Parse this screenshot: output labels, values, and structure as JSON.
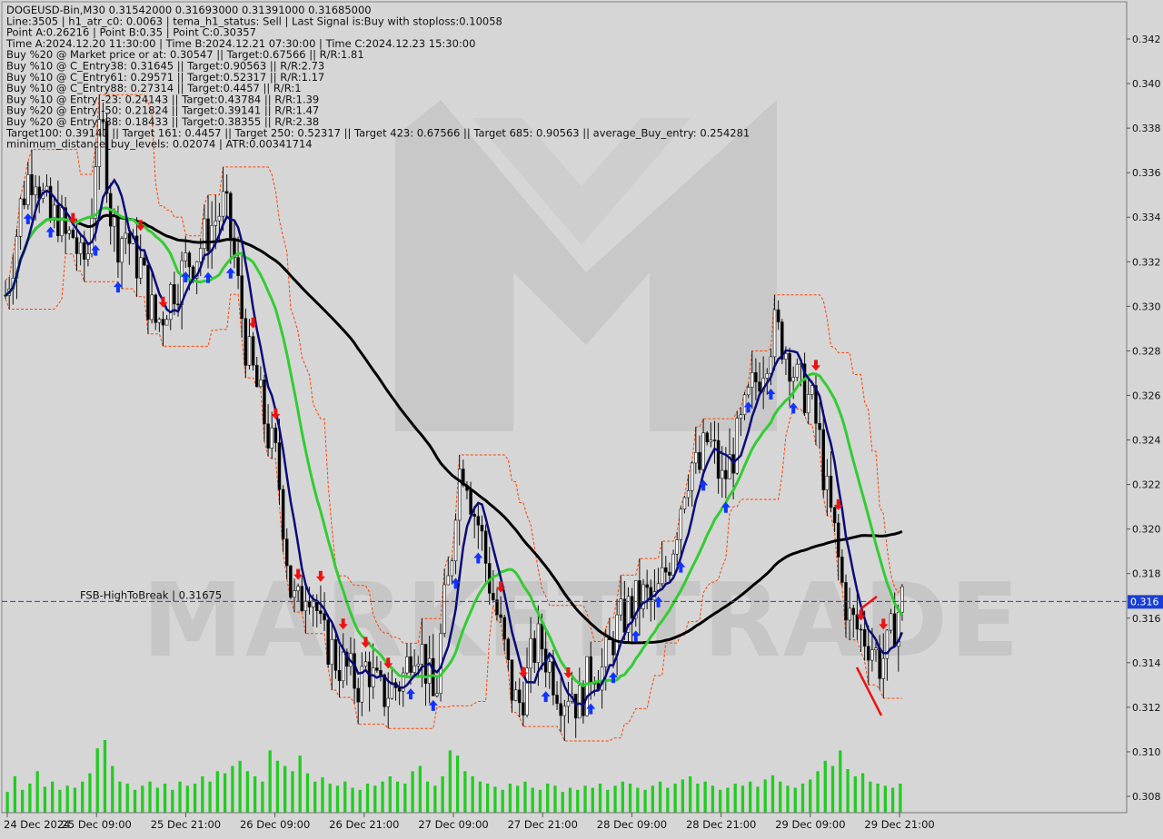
{
  "chart_data": {
    "type": "candlestick",
    "symbol_header": "DOGEUSD-Bin,M30  0.31542000 0.31693000 0.31391000 0.31685000",
    "info_lines": [
      "DOGEUSD-Bin,M30  0.31542000 0.31693000 0.31391000 0.31685000",
      "Line:3505 | h1_atr_c0: 0.0063 | tema_h1_status: Sell | Last Signal is:Buy with stoploss:0.10058",
      "Point A:0.26216 | Point B:0.35 | Point C:0.30357",
      "Time A:2024.12.20 11:30:00 | Time B:2024.12.21 07:30:00 | Time C:2024.12.23 15:30:00",
      "Buy %20 @ Market price or at: 0.30547 || Target:0.67566 || R/R:1.81",
      "Buy %10 @ C_Entry38: 0.31645 || Target:0.90563 || R/R:2.73",
      "Buy %10 @ C_Entry61: 0.29571 || Target:0.52317 || R/R:1.17",
      "Buy %10 @ C_Entry88: 0.27314 || Target:0.4457 || R/R:1",
      "Buy %10 @ Entry -23: 0.24143 || Target:0.43784 || R/R:1.39",
      "Buy %20 @ Entry -50: 0.21824 || Target:0.39141 || R/R:1.47",
      "Buy %20 @ Entry -88: 0.18433 || Target:0.38355 || R/R:2.38",
      "Target100: 0.39141 || Target 161: 0.4457 || Target 250: 0.52317 || Target 423: 0.67566 || Target 685: 0.90563 || average_Buy_entry: 0.254281",
      "minimum_distance_buy_levels: 0.02074 | ATR:0.00341714"
    ],
    "y_ticks": [
      "0.342",
      "0.340",
      "0.338",
      "0.336",
      "0.334",
      "0.332",
      "0.330",
      "0.328",
      "0.326",
      "0.324",
      "0.322",
      "0.320",
      "0.318",
      "0.316",
      "0.314",
      "0.312",
      "0.310",
      "0.308"
    ],
    "y_range": [
      0.3072,
      0.3439
    ],
    "x_ticks": [
      "24 Dec 2024",
      "25 Dec 09:00",
      "25 Dec 21:00",
      "26 Dec 09:00",
      "26 Dec 21:00",
      "27 Dec 09:00",
      "27 Dec 21:00",
      "28 Dec 09:00",
      "28 Dec 21:00",
      "29 Dec 09:00",
      "29 Dec 21:00"
    ],
    "x_range": [
      0,
      100
    ],
    "x_tick_positions": [
      0,
      9.9,
      19.8,
      29.7,
      39.6,
      49.5,
      59.4,
      69.3,
      79.2,
      89.1,
      99
    ],
    "hline": {
      "label": "FSB-HighToBreak | 0.31675",
      "value": 0.31675,
      "color": "#2a3fd6"
    },
    "price_label": "0.316",
    "watermark": "MARKETTRADE",
    "colors": {
      "bull": "#ffffff",
      "bear": "#000000",
      "volume": "#22cc22",
      "ma_fast": "#0a0a78",
      "ma_mid": "#33cc33",
      "ma_slow": "#000000",
      "bands": "#ff4400",
      "buy_arrow": "#1133ff",
      "sell_arrow": "#ee1111"
    },
    "close_series": [
      0.3305,
      0.3322,
      0.3345,
      0.3358,
      0.3362,
      0.3348,
      0.3338,
      0.3341,
      0.333,
      0.3332,
      0.3318,
      0.3325,
      0.337,
      0.3378,
      0.334,
      0.333,
      0.3334,
      0.3322,
      0.3318,
      0.3302,
      0.3292,
      0.3298,
      0.3308,
      0.3312,
      0.332,
      0.3322,
      0.3328,
      0.3334,
      0.334,
      0.3346,
      0.333,
      0.3305,
      0.328,
      0.3268,
      0.3255,
      0.324,
      0.323,
      0.32,
      0.3168,
      0.3165,
      0.3178,
      0.317,
      0.315,
      0.3148,
      0.314,
      0.3138,
      0.3133,
      0.313,
      0.314,
      0.313,
      0.3125,
      0.3128,
      0.313,
      0.3135,
      0.315,
      0.3148,
      0.3135,
      0.312,
      0.316,
      0.318,
      0.3225,
      0.323,
      0.321,
      0.32,
      0.318,
      0.3165,
      0.315,
      0.313,
      0.312,
      0.313,
      0.3145,
      0.315,
      0.314,
      0.3132,
      0.3125,
      0.313,
      0.312,
      0.313,
      0.314,
      0.3135,
      0.3145,
      0.3155,
      0.316,
      0.3165,
      0.3168,
      0.317,
      0.3165,
      0.3175,
      0.3185,
      0.32,
      0.322,
      0.323,
      0.3225,
      0.324,
      0.3235,
      0.322,
      0.3228,
      0.3238,
      0.325,
      0.3262,
      0.327,
      0.328,
      0.329,
      0.3285,
      0.3278,
      0.3266,
      0.3262,
      0.3256,
      0.324,
      0.3215,
      0.3198,
      0.3175,
      0.316,
      0.3155,
      0.3152,
      0.3148,
      0.314,
      0.3145,
      0.3158,
      0.31685
    ],
    "volume_series": [
      20,
      35,
      22,
      28,
      40,
      25,
      30,
      22,
      26,
      24,
      30,
      38,
      62,
      70,
      45,
      30,
      28,
      22,
      26,
      30,
      24,
      28,
      22,
      30,
      26,
      28,
      35,
      30,
      40,
      38,
      45,
      50,
      40,
      35,
      30,
      60,
      50,
      45,
      40,
      55,
      38,
      30,
      34,
      28,
      26,
      30,
      24,
      22,
      28,
      26,
      30,
      35,
      30,
      28,
      40,
      45,
      30,
      26,
      35,
      60,
      55,
      40,
      35,
      30,
      28,
      25,
      22,
      28,
      26,
      30,
      24,
      22,
      28,
      26,
      20,
      24,
      22,
      26,
      24,
      28,
      22,
      26,
      30,
      28,
      24,
      22,
      26,
      30,
      24,
      28,
      32,
      35,
      28,
      30,
      26,
      22,
      24,
      28,
      26,
      30,
      25,
      32,
      36,
      30,
      26,
      24,
      28,
      32,
      40,
      50,
      45,
      60,
      42,
      35,
      38,
      30,
      28,
      26,
      24,
      28
    ]
  }
}
